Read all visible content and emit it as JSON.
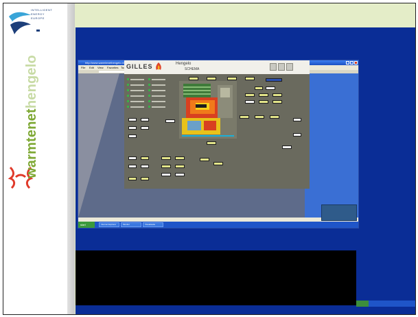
{
  "slide": {
    "brand": {
      "iee_lines": [
        "INTELLIGENT",
        "ENERGY",
        "EUROPE"
      ],
      "name_part1": "warmtenet",
      "name_part2": "hengelo"
    }
  },
  "browser": {
    "title": "http://www.warmtenethengelo.nl - Microsoft Internet Explorer",
    "menu": [
      "File",
      "Edit",
      "View",
      "Favorites",
      "Tools",
      "Help"
    ],
    "status": "Done"
  },
  "scada": {
    "brand": "GILLES",
    "title": "Hengelo",
    "subtitle": "SCHEMA"
  },
  "inner_taskbar": {
    "start_label": "start",
    "tasks": [
      "Internet Explorer",
      "Monitor",
      "Visualisatie"
    ]
  },
  "colors": {
    "desktop_blue": "#0a2d96",
    "slide_bg": "#e4edc8",
    "brand_green": "#7ea834",
    "scada_panel": "#6a6a5e"
  }
}
